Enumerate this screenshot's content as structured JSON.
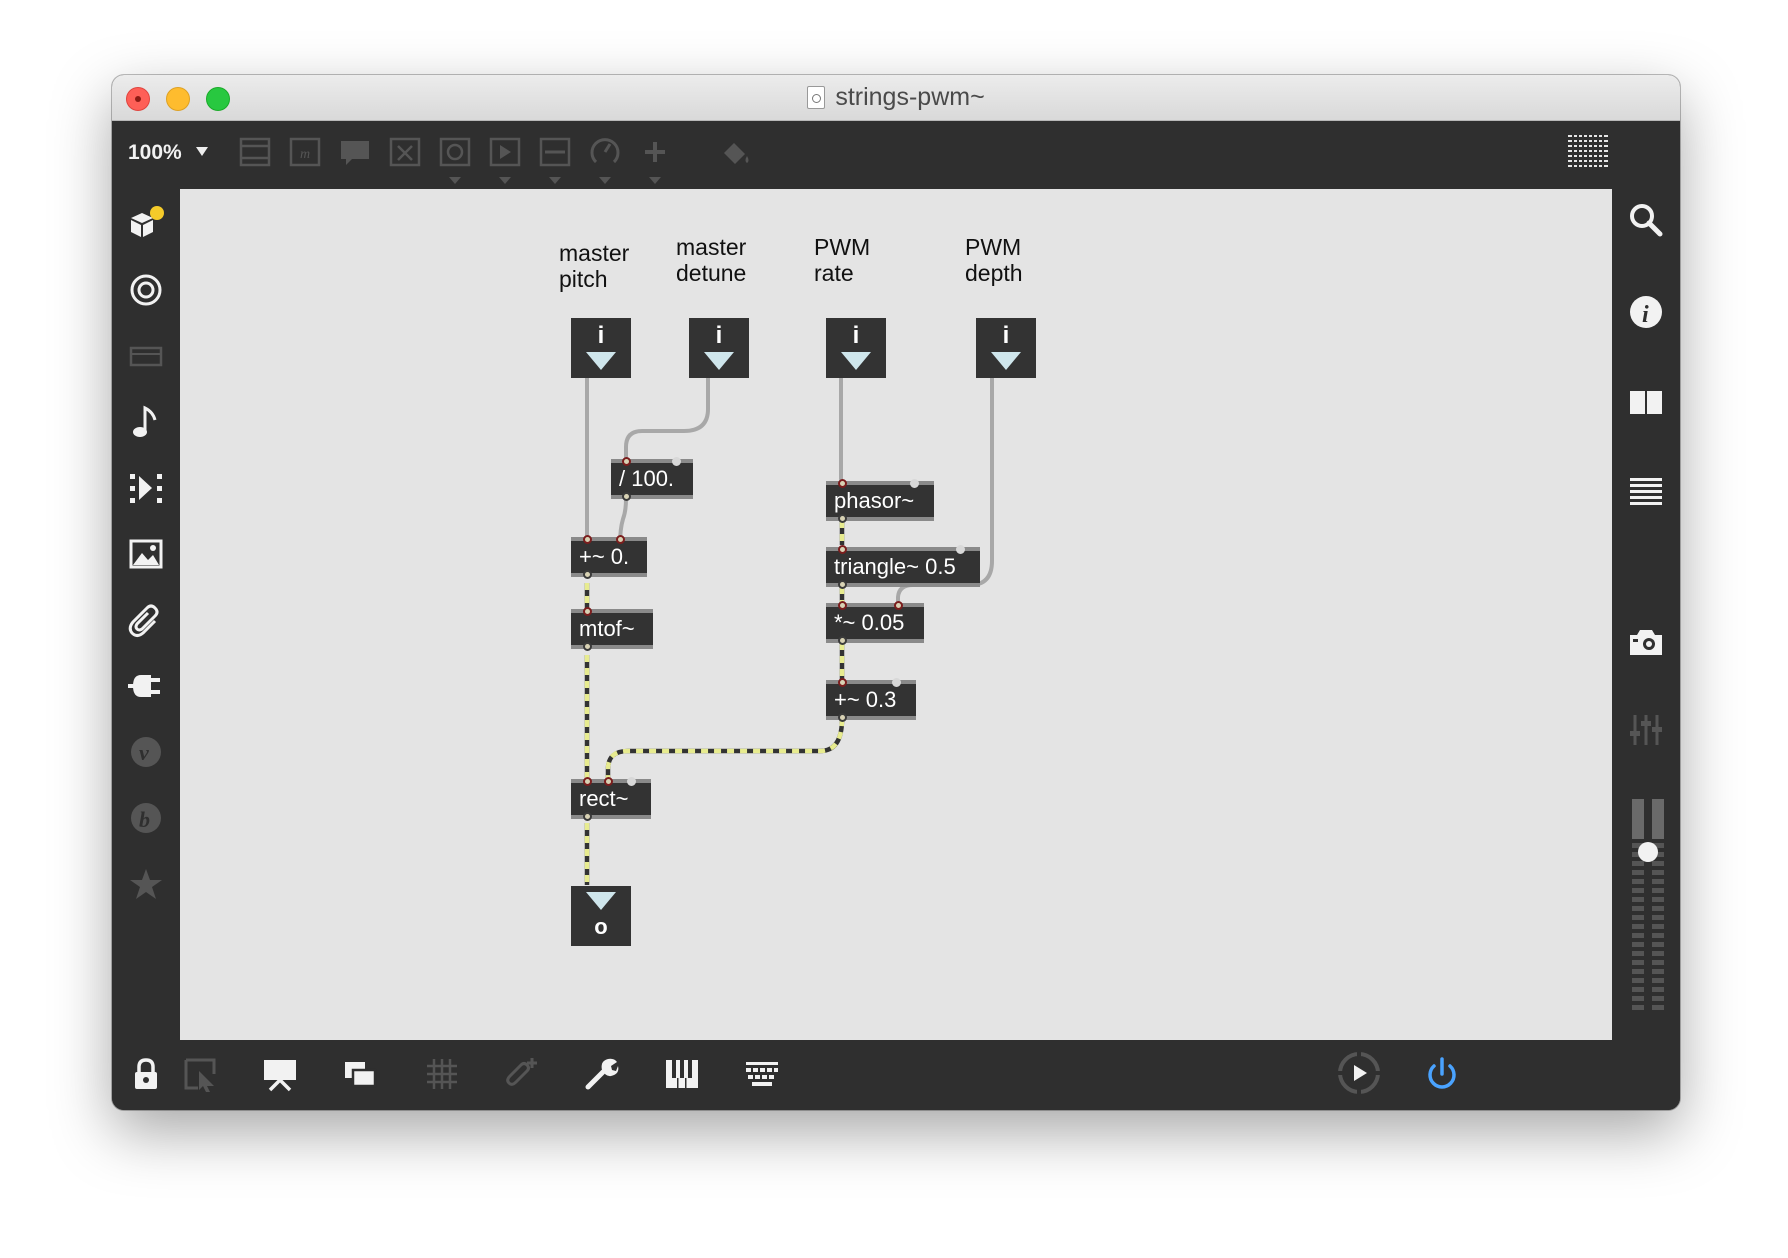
{
  "window": {
    "title": "strings-pwm~"
  },
  "toolbar": {
    "zoom": "100%",
    "icons": [
      "new-object-icon",
      "message-icon",
      "comment-icon",
      "button-icon",
      "toggle-icon",
      "number-icon",
      "slider-icon",
      "dial-icon",
      "add-icon",
      "paint-bucket-icon",
      "grid-view-icon"
    ]
  },
  "patch": {
    "comments": {
      "master_pitch": "master\npitch",
      "master_detune": "master\ndetune",
      "pwm_rate": "PWM\nrate",
      "pwm_depth": "PWM\ndepth"
    },
    "numbox_label": "i",
    "out_numbox_label": "o",
    "objects": {
      "divide": "/ 100.",
      "plus_pitch": "+~ 0.",
      "mtof": "mtof~",
      "phasor": "phasor~",
      "triangle": "triangle~ 0.5",
      "mult": "*~ 0.05",
      "plus_offset": "+~ 0.3",
      "rect": "rect~"
    }
  },
  "colors": {
    "signal_cord": "#e7eb8f",
    "control_cord": "#a8a8a8",
    "canvas": "#e4e4e4",
    "chrome": "#2f2f2f",
    "power": "#4aa3ff"
  }
}
